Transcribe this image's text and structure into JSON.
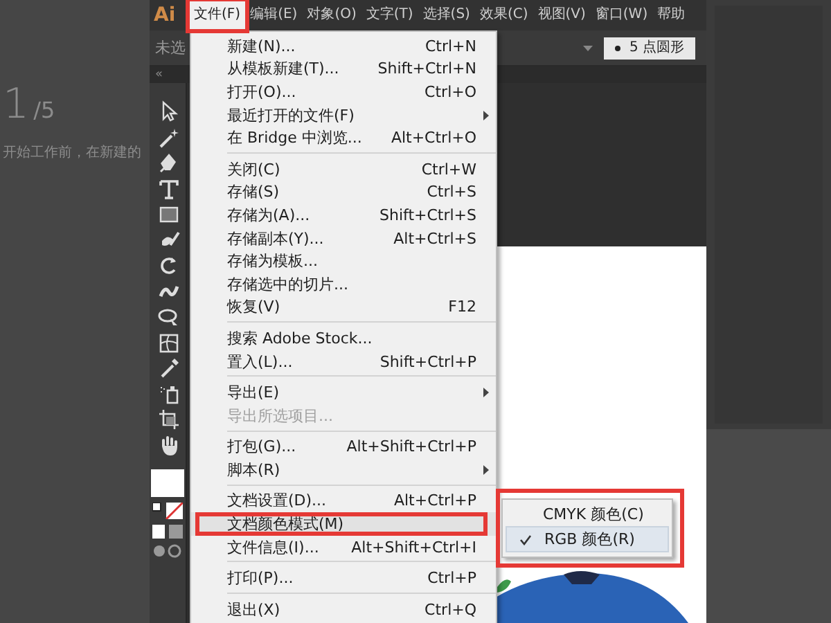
{
  "left_panel": {
    "step": "1",
    "step_total": "/5",
    "text": "开始工作前，在新建的"
  },
  "menubar": {
    "logo": "Ai",
    "items": [
      {
        "label": "文件(F)",
        "selected": true,
        "highlighted": true
      },
      {
        "label": "编辑(E)",
        "selected": false,
        "highlighted": false
      },
      {
        "label": "对象(O)",
        "selected": false,
        "highlighted": false
      },
      {
        "label": "文字(T)",
        "selected": false,
        "highlighted": false
      },
      {
        "label": "选择(S)",
        "selected": false,
        "highlighted": false
      },
      {
        "label": "效果(C)",
        "selected": false,
        "highlighted": false
      },
      {
        "label": "视图(V)",
        "selected": false,
        "highlighted": false
      },
      {
        "label": "窗口(W)",
        "selected": false,
        "highlighted": false
      },
      {
        "label": "帮助",
        "selected": false,
        "highlighted": false
      }
    ]
  },
  "control_bar": {
    "selection": "未选",
    "brush": "5 点圆形",
    "collapse": "«"
  },
  "file_menu": {
    "groups": [
      [
        {
          "label": "新建(N)...",
          "shortcut": "Ctrl+N",
          "kind": "command",
          "disabled": false,
          "selected": false,
          "highlighted": false
        },
        {
          "label": "从模板新建(T)...",
          "shortcut": "Shift+Ctrl+N",
          "kind": "command",
          "disabled": false,
          "selected": false,
          "highlighted": false
        },
        {
          "label": "打开(O)...",
          "shortcut": "Ctrl+O",
          "kind": "command",
          "disabled": false,
          "selected": false,
          "highlighted": false
        },
        {
          "label": "最近打开的文件(F)",
          "kind": "submenu",
          "disabled": false,
          "selected": false,
          "highlighted": false
        },
        {
          "label": "在 Bridge 中浏览...",
          "shortcut": "Alt+Ctrl+O",
          "kind": "command",
          "disabled": false,
          "selected": false,
          "highlighted": false
        }
      ],
      [
        {
          "label": "关闭(C)",
          "shortcut": "Ctrl+W",
          "kind": "command",
          "disabled": false,
          "selected": false,
          "highlighted": false
        },
        {
          "label": "存储(S)",
          "shortcut": "Ctrl+S",
          "kind": "command",
          "disabled": false,
          "selected": false,
          "highlighted": false
        },
        {
          "label": "存储为(A)...",
          "shortcut": "Shift+Ctrl+S",
          "kind": "command",
          "disabled": false,
          "selected": false,
          "highlighted": false
        },
        {
          "label": "存储副本(Y)...",
          "shortcut": "Alt+Ctrl+S",
          "kind": "command",
          "disabled": false,
          "selected": false,
          "highlighted": false
        },
        {
          "label": "存储为模板...",
          "kind": "command",
          "disabled": false,
          "selected": false,
          "highlighted": false
        },
        {
          "label": "存储选中的切片...",
          "kind": "command",
          "disabled": false,
          "selected": false,
          "highlighted": false
        },
        {
          "label": "恢复(V)",
          "shortcut": "F12",
          "kind": "command",
          "disabled": false,
          "selected": false,
          "highlighted": false
        }
      ],
      [
        {
          "label": "搜索 Adobe Stock...",
          "kind": "command",
          "disabled": false,
          "selected": false,
          "highlighted": false
        },
        {
          "label": "置入(L)...",
          "shortcut": "Shift+Ctrl+P",
          "kind": "command",
          "disabled": false,
          "selected": false,
          "highlighted": false
        }
      ],
      [
        {
          "label": "导出(E)",
          "kind": "submenu",
          "disabled": false,
          "selected": false,
          "highlighted": false
        },
        {
          "label": "导出所选项目...",
          "kind": "command",
          "disabled": true,
          "selected": false,
          "highlighted": false
        }
      ],
      [
        {
          "label": "打包(G)...",
          "shortcut": "Alt+Shift+Ctrl+P",
          "kind": "command",
          "disabled": false,
          "selected": false,
          "highlighted": false
        },
        {
          "label": "脚本(R)",
          "kind": "submenu",
          "disabled": false,
          "selected": false,
          "highlighted": false
        }
      ],
      [
        {
          "label": "文档设置(D)...",
          "shortcut": "Alt+Ctrl+P",
          "kind": "command",
          "disabled": false,
          "selected": false,
          "highlighted": false
        },
        {
          "label": "文档颜色模式(M)",
          "kind": "command",
          "disabled": false,
          "selected": true,
          "highlighted": true
        },
        {
          "label": "文件信息(I)...",
          "shortcut": "Alt+Shift+Ctrl+I",
          "kind": "command",
          "disabled": false,
          "selected": false,
          "highlighted": false
        }
      ],
      [
        {
          "label": "打印(P)...",
          "shortcut": "Ctrl+P",
          "kind": "command",
          "disabled": false,
          "selected": false,
          "highlighted": false
        }
      ],
      [
        {
          "label": "退出(X)",
          "shortcut": "Ctrl+Q",
          "kind": "command",
          "disabled": false,
          "selected": false,
          "highlighted": false
        }
      ]
    ]
  },
  "color_mode_submenu": {
    "highlighted": true,
    "items": [
      {
        "label": "CMYK 颜色(C)",
        "checked": false
      },
      {
        "label": "RGB 颜色(R)",
        "checked": true
      }
    ]
  }
}
